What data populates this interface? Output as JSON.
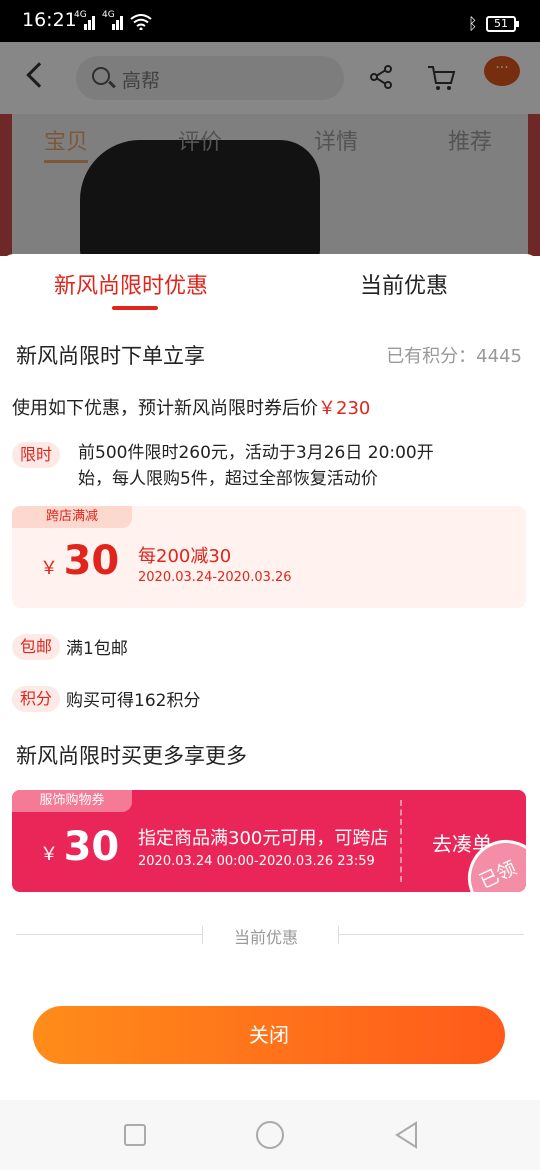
{
  "status_bar": {
    "time": "16:21",
    "network1": "4G",
    "network2": "4G",
    "battery": "51"
  },
  "background_page": {
    "search_text": "高帮",
    "more_label": "···",
    "tabs": [
      "宝贝",
      "评价",
      "详情",
      "推荐"
    ]
  },
  "sheet": {
    "tabs": [
      {
        "label": "新风尚限时优惠",
        "active": true
      },
      {
        "label": "当前优惠",
        "active": false
      }
    ],
    "section1_title": "新风尚限时下单立享",
    "points_label": "已有积分：4445",
    "estimate_prefix": "使用如下优惠，预计新风尚限时券后价",
    "estimate_price": "￥230",
    "limited": {
      "tag": "限时",
      "text": "前500件限时260元，活动于3月26日 20:00开始，每人限购5件，超过全部恢复活动价"
    },
    "coupon_store": {
      "ribbon": "跨店满减",
      "currency": "￥",
      "amount": "30",
      "rule": "每200减30",
      "date": "2020.03.24-2020.03.26"
    },
    "shipping": {
      "tag": "包邮",
      "text": "满1包邮"
    },
    "points_reward": {
      "tag": "积分",
      "text": "购买可得162积分"
    },
    "section2_title": "新风尚限时买更多享更多",
    "coupon_apparel": {
      "ribbon": "服饰购物券",
      "currency": "￥",
      "amount": "30",
      "rule": "指定商品满300元可用，可跨店",
      "date": "2020.03.24 00:00-2020.03.26 23:59",
      "action": "去凑单",
      "stamp": "已领"
    },
    "divider_label": "当前优惠",
    "close_label": "关闭"
  },
  "colors": {
    "accent": "#e0261c",
    "coupon_pink": "#ea2557",
    "button_orange": "#ff6a1a"
  }
}
